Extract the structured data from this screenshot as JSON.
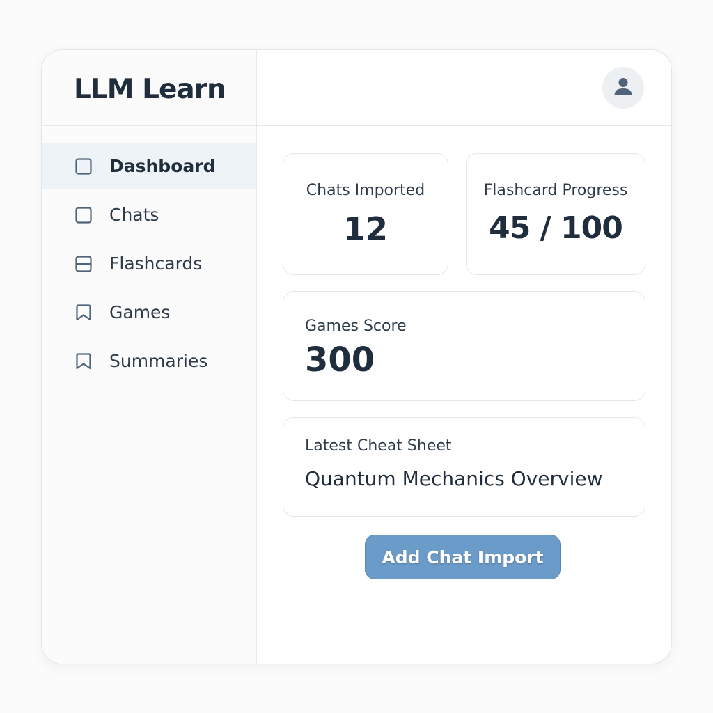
{
  "app": {
    "title": "LLM Learn"
  },
  "sidebar": {
    "items": [
      {
        "label": "Dashboard",
        "icon": "square-icon",
        "active": true
      },
      {
        "label": "Chats",
        "icon": "square-icon",
        "active": false
      },
      {
        "label": "Flashcards",
        "icon": "card-icon",
        "active": false
      },
      {
        "label": "Games",
        "icon": "bookmark-icon",
        "active": false
      },
      {
        "label": "Summaries",
        "icon": "bookmark-icon",
        "active": false
      }
    ]
  },
  "header": {
    "avatar_icon": "user-icon"
  },
  "stats": {
    "chats": {
      "label": "Chats Imported",
      "value": "12"
    },
    "flashcards": {
      "label": "Flashcard Progress",
      "value": "45 / 100",
      "completed": 45,
      "total": 100
    },
    "games": {
      "label": "Games Score",
      "value": "300"
    }
  },
  "cheat_sheet": {
    "label": "Latest Cheat Sheet",
    "title": "Quantum Mechanics Overview"
  },
  "actions": {
    "add_import_label": "Add Chat Import"
  },
  "colors": {
    "accent": "#6b9bc8",
    "text": "#1f2d3d",
    "active_nav_bg": "#eef3f8",
    "icon": "#4e6478"
  }
}
